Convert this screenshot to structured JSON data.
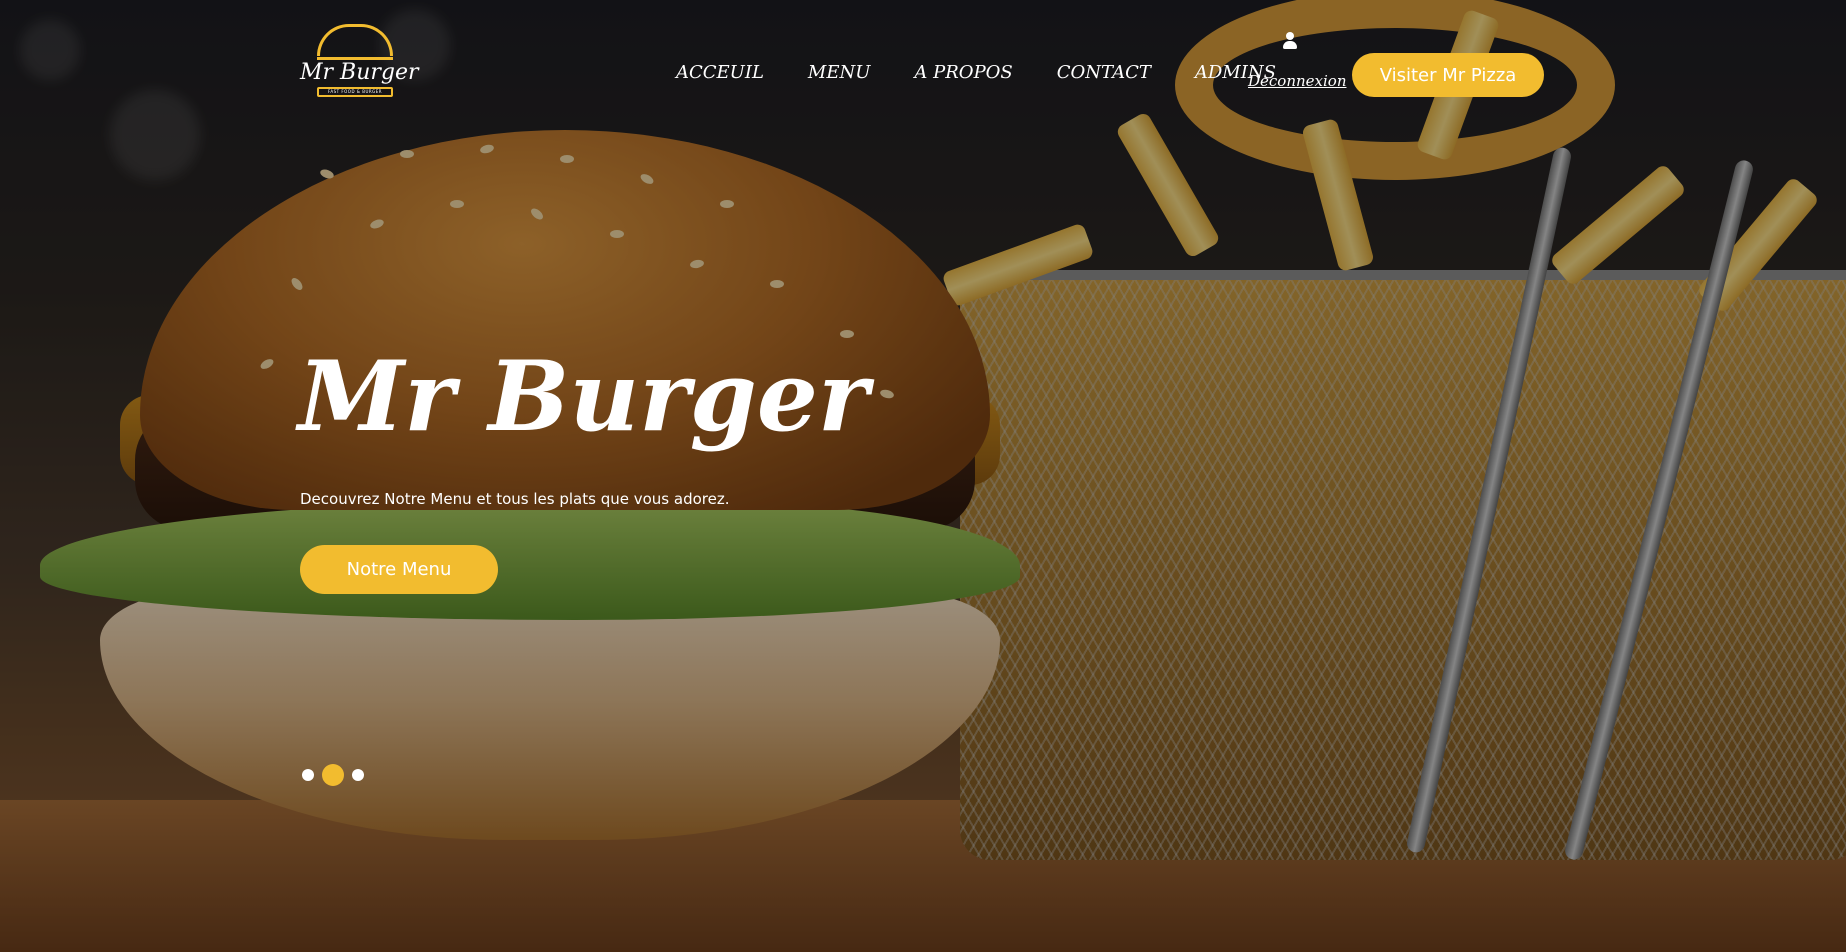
{
  "brand": {
    "name": "Mr Burger",
    "tagline": "FAST FOOD & BURGER",
    "accent_color": "#f2bc2f"
  },
  "nav": {
    "items": [
      {
        "label": "ACCEUIL"
      },
      {
        "label": "MENU"
      },
      {
        "label": "A PROPOS"
      },
      {
        "label": "CONTACT"
      },
      {
        "label": "ADMINS"
      }
    ],
    "user_icon": "user-icon",
    "logout_label": "Deconnexion",
    "visit_label": "Visiter Mr Pizza"
  },
  "hero": {
    "title": "Mr Burger",
    "subtitle": "Decouvrez Notre Menu et tous les plats que vous adorez.",
    "cta_label": "Notre Menu",
    "slides": {
      "count": 3,
      "active_index": 1
    }
  }
}
